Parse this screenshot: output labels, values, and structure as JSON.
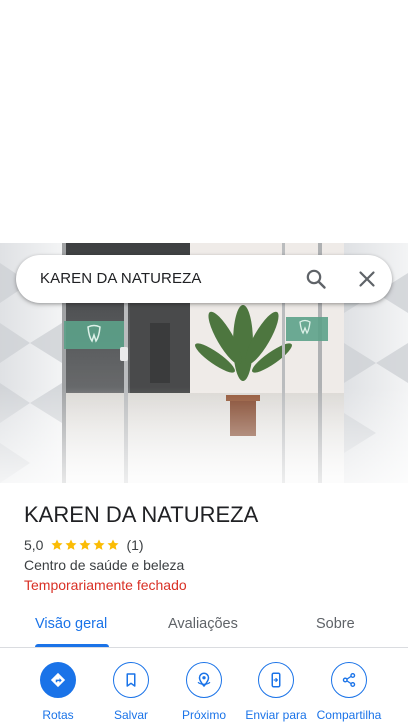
{
  "search": {
    "query": "KAREN DA NATUREZA"
  },
  "place": {
    "name": "KAREN DA NATUREZA",
    "rating": "5,0",
    "review_count": "(1)",
    "stars": 5,
    "category": "Centro de saúde e beleza",
    "status": "Temporariamente fechado"
  },
  "tabs": [
    {
      "label": "Visão geral",
      "active": true
    },
    {
      "label": "Avaliações",
      "active": false
    },
    {
      "label": "Sobre",
      "active": false
    }
  ],
  "actions": [
    {
      "label": "Rotas",
      "icon": "directions-icon"
    },
    {
      "label": "Salvar",
      "icon": "bookmark-icon"
    },
    {
      "label": "Próximo",
      "icon": "nearby-icon"
    },
    {
      "label": "Enviar para",
      "icon": "send-to-phone-icon"
    },
    {
      "label": "Compartilha",
      "icon": "share-icon"
    }
  ],
  "colors": {
    "accent": "#1a73e8",
    "closed": "#d93025",
    "star": "#fbbc04",
    "text": "#202124",
    "secondary_text": "#3c4043"
  }
}
